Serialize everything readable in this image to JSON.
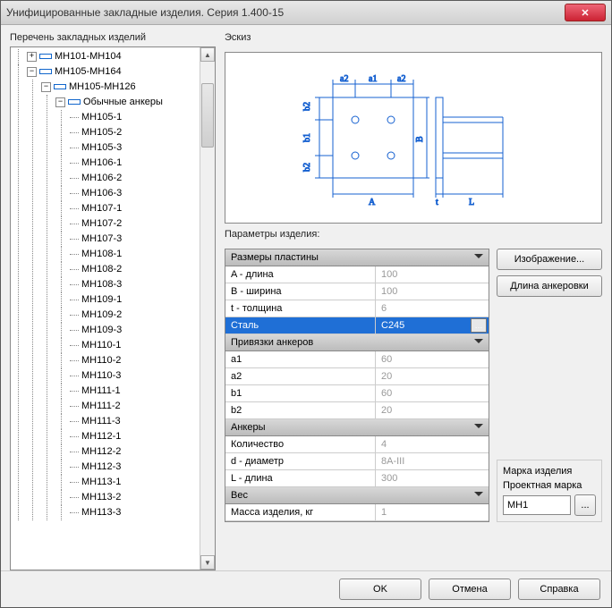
{
  "window": {
    "title": "Унифицированные закладные изделия. Серия 1.400-15"
  },
  "labels": {
    "tree_title": "Перечень закладных изделий",
    "sketch": "Эскиз",
    "params": "Параметры изделия:",
    "mark_group": "Марка изделия",
    "mark_label": "Проектная марка"
  },
  "buttons": {
    "image": "Изображение...",
    "anchor_len": "Длина анкеровки",
    "ok": "OK",
    "cancel": "Отмена",
    "help": "Справка",
    "ellipsis": "..."
  },
  "tree": {
    "n0": "МН101-МН104",
    "n1": "МН105-МН164",
    "n2": "МН105-МН126",
    "n3": "Обычные анкеры",
    "leaves": [
      "МН105-1",
      "МН105-2",
      "МН105-3",
      "МН106-1",
      "МН106-2",
      "МН106-3",
      "МН107-1",
      "МН107-2",
      "МН107-3",
      "МН108-1",
      "МН108-2",
      "МН108-3",
      "МН109-1",
      "МН109-2",
      "МН109-3",
      "МН110-1",
      "МН110-2",
      "МН110-3",
      "МН111-1",
      "МН111-2",
      "МН111-3",
      "МН112-1",
      "МН112-2",
      "МН112-3",
      "МН113-1",
      "МН113-2",
      "МН113-3"
    ]
  },
  "sketch_dims": {
    "a1": "a1",
    "a2l": "a2",
    "a2r": "a2",
    "b1": "b1",
    "b2t": "b2",
    "b2b": "b2",
    "A": "A",
    "B": "B",
    "t": "t",
    "L": "L"
  },
  "grid": {
    "g0": {
      "title": "Размеры пластины",
      "rows": [
        {
          "k": "A - длина",
          "v": "100"
        },
        {
          "k": "B - ширина",
          "v": "100"
        },
        {
          "k": "t - толщина",
          "v": "6"
        },
        {
          "k": "Сталь",
          "v": "C245",
          "sel": true
        }
      ]
    },
    "g1": {
      "title": "Привязки анкеров",
      "rows": [
        {
          "k": "a1",
          "v": "60"
        },
        {
          "k": "a2",
          "v": "20"
        },
        {
          "k": "b1",
          "v": "60"
        },
        {
          "k": "b2",
          "v": "20"
        }
      ]
    },
    "g2": {
      "title": "Анкеры",
      "rows": [
        {
          "k": "Количество",
          "v": "4"
        },
        {
          "k": "d - диаметр",
          "v": "8A-III"
        },
        {
          "k": "L - длина",
          "v": "300"
        }
      ]
    },
    "g3": {
      "title": "Вес",
      "rows": [
        {
          "k": "Масса изделия, кг",
          "v": "1"
        }
      ]
    }
  },
  "mark": {
    "value": "МН1"
  }
}
